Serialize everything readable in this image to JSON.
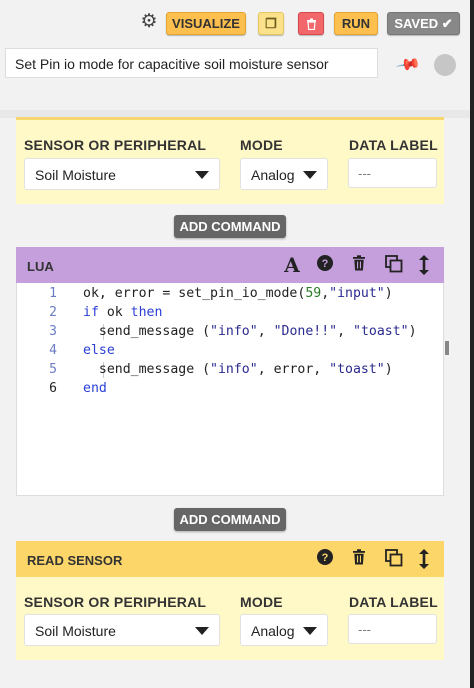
{
  "toolbar": {
    "visualize": "VISUALIZE",
    "run": "RUN",
    "saved": "SAVED ✔",
    "settings_icon": "gear-icon",
    "copy_icon": "copy-icon",
    "delete_icon": "trash-icon"
  },
  "sequence": {
    "title": "Set Pin io mode for capacitive soil moisture sensor"
  },
  "step1": {
    "sensor_label": "SENSOR OR PERIPHERAL",
    "sensor_value": "Soil Moisture",
    "mode_label": "MODE",
    "mode_value": "Analog",
    "data_label_label": "DATA LABEL",
    "data_label_placeholder": "---"
  },
  "add_command_1": "ADD COMMAND",
  "lua": {
    "title": "LUA",
    "line_numbers": [
      "1",
      "2",
      "3",
      "4",
      "5",
      "6"
    ]
  },
  "add_command_2": "ADD COMMAND",
  "read_sensor": {
    "title": "READ SENSOR",
    "sensor_label": "SENSOR OR PERIPHERAL",
    "sensor_value": "Soil Moisture",
    "mode_label": "MODE",
    "mode_value": "Analog",
    "data_label_label": "DATA LABEL",
    "data_label_placeholder": "---"
  },
  "colors": {
    "accent_orange": "#fdbf4d",
    "lua_header": "#c49fdb",
    "read_sensor_header": "#fcd669",
    "panel_background": "#fff9c7",
    "delete_red": "#f2676b"
  }
}
